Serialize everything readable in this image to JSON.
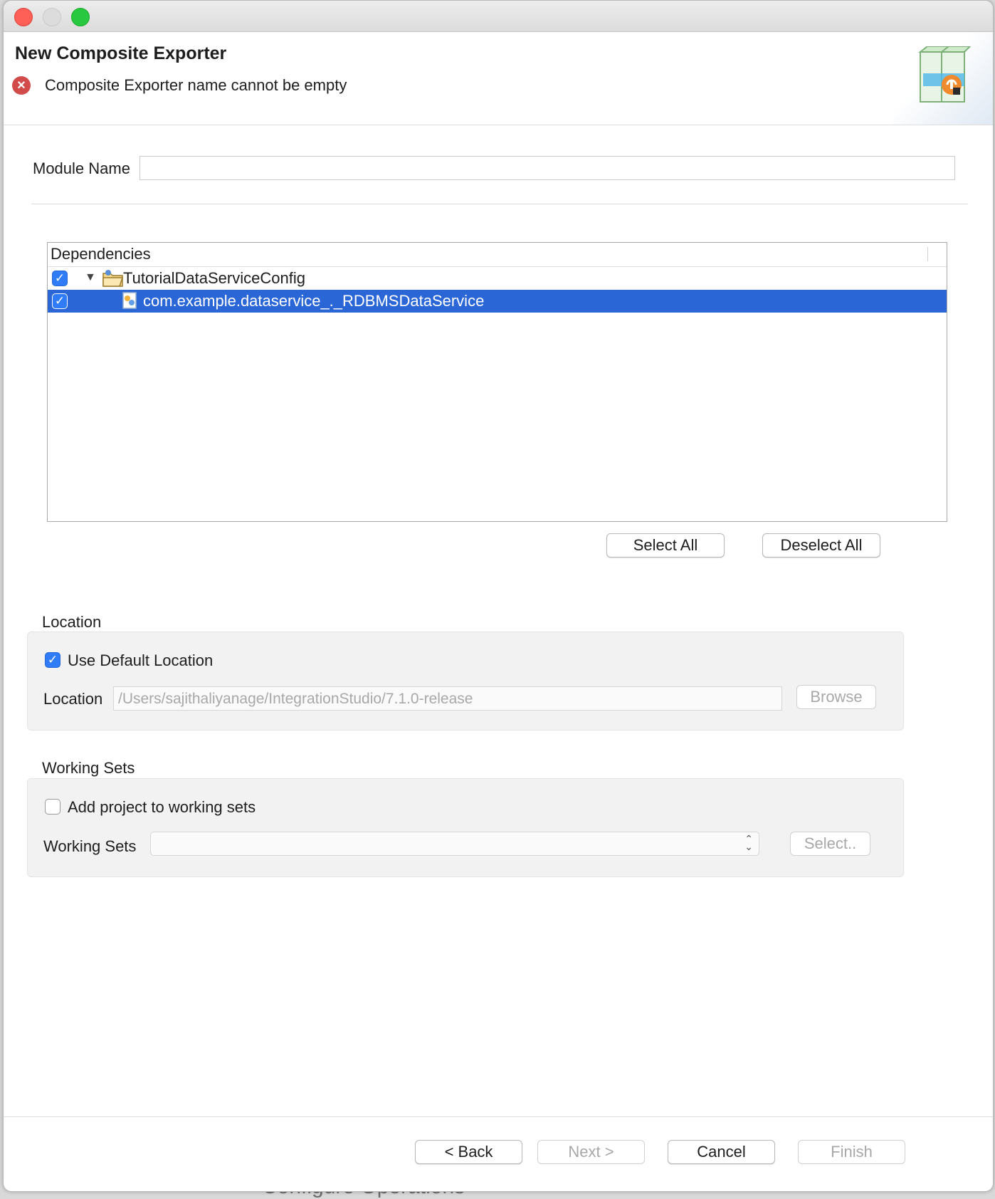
{
  "background": {
    "bottom_text": "Configure Operations"
  },
  "window": {
    "header": {
      "title": "New Composite Exporter",
      "error_message": "Composite Exporter name cannot be empty"
    },
    "module": {
      "label": "Module Name",
      "value": ""
    },
    "dependencies": {
      "header": "Dependencies",
      "rows": [
        {
          "label": "TutorialDataServiceConfig",
          "checked": true,
          "expanded": true,
          "selected": false
        },
        {
          "label": "com.example.dataservice_._RDBMSDataService",
          "checked": true,
          "selected": true
        }
      ],
      "select_all": "Select All",
      "deselect_all": "Deselect All"
    },
    "location": {
      "group_label": "Location",
      "use_default_label": "Use Default Location",
      "use_default_checked": true,
      "field_label": "Location",
      "path": "/Users/sajithaliyanage/IntegrationStudio/7.1.0-release",
      "browse": "Browse"
    },
    "working_sets": {
      "group_label": "Working Sets",
      "add_label": "Add project to working sets",
      "add_checked": false,
      "field_label": "Working Sets",
      "selected_value": "",
      "select_button": "Select.."
    },
    "footer": {
      "back": "< Back",
      "next": "Next >",
      "cancel": "Cancel",
      "finish": "Finish"
    },
    "colors": {
      "selection": "#2a66d6",
      "checkbox": "#2f7cf6",
      "error": "#d24b4b"
    }
  }
}
